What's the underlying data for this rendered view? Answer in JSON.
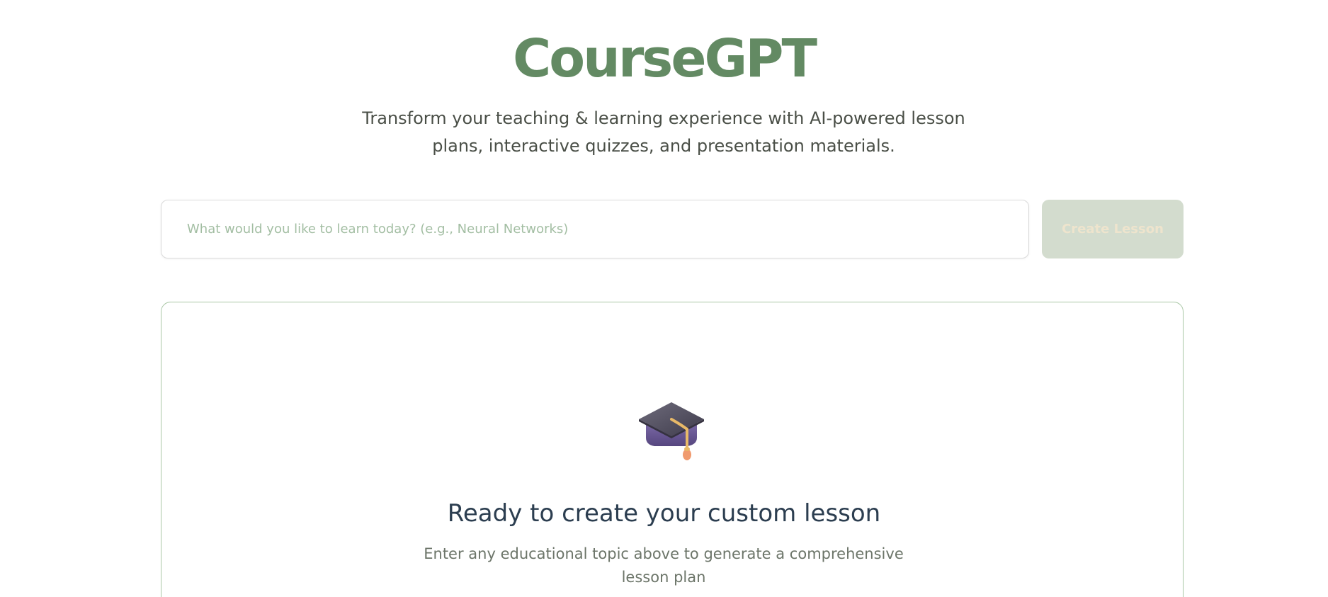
{
  "header": {
    "title": "CourseGPT",
    "subtitle": "Transform your teaching & learning experience with AI-powered lesson plans, interactive quizzes, and presentation materials."
  },
  "search": {
    "placeholder": "What would you like to learn today? (e.g., Neural Networks)",
    "value": "",
    "button_label": "Create Lesson"
  },
  "empty_state": {
    "icon": "graduation-cap-icon",
    "heading": "Ready to create your custom lesson",
    "description": "Enter any educational topic above to generate a comprehensive lesson plan"
  },
  "colors": {
    "brand": "#638a63",
    "button_disabled_bg": "#d3dcce",
    "card_border": "#a9c7a5",
    "heading": "#2c3e50"
  }
}
